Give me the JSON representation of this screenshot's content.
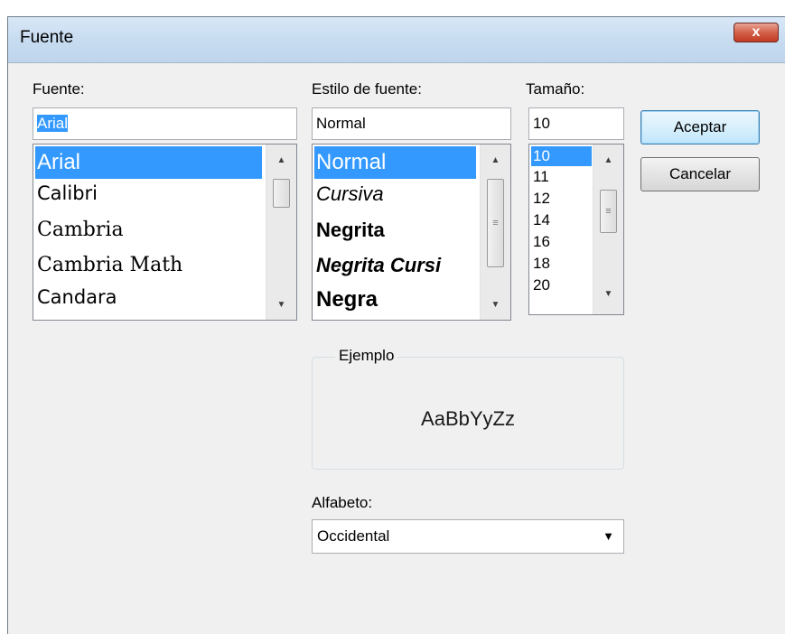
{
  "window": {
    "title": "Fuente",
    "close_label": "x"
  },
  "font": {
    "label": "Fuente:",
    "value": "Arial",
    "items": [
      "Arial",
      "Calibri",
      "Cambria",
      "Cambria Math",
      "Candara"
    ],
    "selected": "Arial"
  },
  "style": {
    "label": "Estilo de fuente:",
    "value": "Normal",
    "items": [
      "Normal",
      "Cursiva",
      "Negrita",
      "Negrita Cursi",
      "Negra"
    ],
    "selected": "Normal"
  },
  "size": {
    "label": "Tamaño:",
    "value": "10",
    "items": [
      "10",
      "11",
      "12",
      "14",
      "16",
      "18",
      "20"
    ],
    "selected": "10"
  },
  "buttons": {
    "ok": "Aceptar",
    "cancel": "Cancelar"
  },
  "sample": {
    "caption": "Ejemplo",
    "text": "AaBbYyZz"
  },
  "script": {
    "label": "Alfabeto:",
    "value": "Occidental"
  },
  "icons": {
    "scroll_up": "▲",
    "scroll_down": "▼",
    "grip": "≡",
    "combo_arrow": "▼"
  },
  "colors": {
    "selection": "#3399ff",
    "close_button": "#c13b22",
    "title_bar": "#c6dbf0"
  }
}
